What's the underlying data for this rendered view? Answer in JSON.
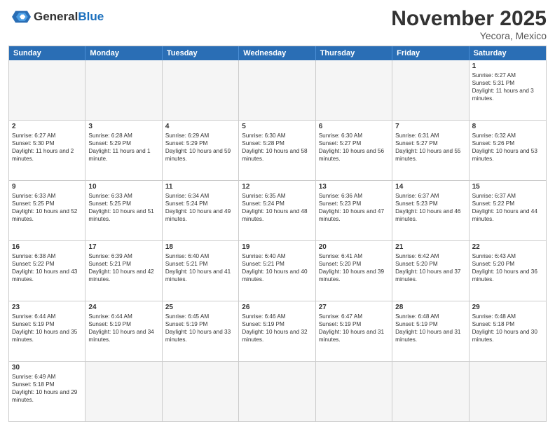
{
  "header": {
    "logo_general": "General",
    "logo_blue": "Blue",
    "title": "November 2025",
    "subtitle": "Yecora, Mexico"
  },
  "days_of_week": [
    "Sunday",
    "Monday",
    "Tuesday",
    "Wednesday",
    "Thursday",
    "Friday",
    "Saturday"
  ],
  "weeks": [
    [
      {
        "day": "",
        "text": ""
      },
      {
        "day": "",
        "text": ""
      },
      {
        "day": "",
        "text": ""
      },
      {
        "day": "",
        "text": ""
      },
      {
        "day": "",
        "text": ""
      },
      {
        "day": "",
        "text": ""
      },
      {
        "day": "1",
        "text": "Sunrise: 6:27 AM\nSunset: 5:31 PM\nDaylight: 11 hours and 3 minutes."
      }
    ],
    [
      {
        "day": "2",
        "text": "Sunrise: 6:27 AM\nSunset: 5:30 PM\nDaylight: 11 hours and 2 minutes."
      },
      {
        "day": "3",
        "text": "Sunrise: 6:28 AM\nSunset: 5:29 PM\nDaylight: 11 hours and 1 minute."
      },
      {
        "day": "4",
        "text": "Sunrise: 6:29 AM\nSunset: 5:29 PM\nDaylight: 10 hours and 59 minutes."
      },
      {
        "day": "5",
        "text": "Sunrise: 6:30 AM\nSunset: 5:28 PM\nDaylight: 10 hours and 58 minutes."
      },
      {
        "day": "6",
        "text": "Sunrise: 6:30 AM\nSunset: 5:27 PM\nDaylight: 10 hours and 56 minutes."
      },
      {
        "day": "7",
        "text": "Sunrise: 6:31 AM\nSunset: 5:27 PM\nDaylight: 10 hours and 55 minutes."
      },
      {
        "day": "8",
        "text": "Sunrise: 6:32 AM\nSunset: 5:26 PM\nDaylight: 10 hours and 53 minutes."
      }
    ],
    [
      {
        "day": "9",
        "text": "Sunrise: 6:33 AM\nSunset: 5:25 PM\nDaylight: 10 hours and 52 minutes."
      },
      {
        "day": "10",
        "text": "Sunrise: 6:33 AM\nSunset: 5:25 PM\nDaylight: 10 hours and 51 minutes."
      },
      {
        "day": "11",
        "text": "Sunrise: 6:34 AM\nSunset: 5:24 PM\nDaylight: 10 hours and 49 minutes."
      },
      {
        "day": "12",
        "text": "Sunrise: 6:35 AM\nSunset: 5:24 PM\nDaylight: 10 hours and 48 minutes."
      },
      {
        "day": "13",
        "text": "Sunrise: 6:36 AM\nSunset: 5:23 PM\nDaylight: 10 hours and 47 minutes."
      },
      {
        "day": "14",
        "text": "Sunrise: 6:37 AM\nSunset: 5:23 PM\nDaylight: 10 hours and 46 minutes."
      },
      {
        "day": "15",
        "text": "Sunrise: 6:37 AM\nSunset: 5:22 PM\nDaylight: 10 hours and 44 minutes."
      }
    ],
    [
      {
        "day": "16",
        "text": "Sunrise: 6:38 AM\nSunset: 5:22 PM\nDaylight: 10 hours and 43 minutes."
      },
      {
        "day": "17",
        "text": "Sunrise: 6:39 AM\nSunset: 5:21 PM\nDaylight: 10 hours and 42 minutes."
      },
      {
        "day": "18",
        "text": "Sunrise: 6:40 AM\nSunset: 5:21 PM\nDaylight: 10 hours and 41 minutes."
      },
      {
        "day": "19",
        "text": "Sunrise: 6:40 AM\nSunset: 5:21 PM\nDaylight: 10 hours and 40 minutes."
      },
      {
        "day": "20",
        "text": "Sunrise: 6:41 AM\nSunset: 5:20 PM\nDaylight: 10 hours and 39 minutes."
      },
      {
        "day": "21",
        "text": "Sunrise: 6:42 AM\nSunset: 5:20 PM\nDaylight: 10 hours and 37 minutes."
      },
      {
        "day": "22",
        "text": "Sunrise: 6:43 AM\nSunset: 5:20 PM\nDaylight: 10 hours and 36 minutes."
      }
    ],
    [
      {
        "day": "23",
        "text": "Sunrise: 6:44 AM\nSunset: 5:19 PM\nDaylight: 10 hours and 35 minutes."
      },
      {
        "day": "24",
        "text": "Sunrise: 6:44 AM\nSunset: 5:19 PM\nDaylight: 10 hours and 34 minutes."
      },
      {
        "day": "25",
        "text": "Sunrise: 6:45 AM\nSunset: 5:19 PM\nDaylight: 10 hours and 33 minutes."
      },
      {
        "day": "26",
        "text": "Sunrise: 6:46 AM\nSunset: 5:19 PM\nDaylight: 10 hours and 32 minutes."
      },
      {
        "day": "27",
        "text": "Sunrise: 6:47 AM\nSunset: 5:19 PM\nDaylight: 10 hours and 31 minutes."
      },
      {
        "day": "28",
        "text": "Sunrise: 6:48 AM\nSunset: 5:19 PM\nDaylight: 10 hours and 31 minutes."
      },
      {
        "day": "29",
        "text": "Sunrise: 6:48 AM\nSunset: 5:18 PM\nDaylight: 10 hours and 30 minutes."
      }
    ],
    [
      {
        "day": "30",
        "text": "Sunrise: 6:49 AM\nSunset: 5:18 PM\nDaylight: 10 hours and 29 minutes."
      },
      {
        "day": "",
        "text": ""
      },
      {
        "day": "",
        "text": ""
      },
      {
        "day": "",
        "text": ""
      },
      {
        "day": "",
        "text": ""
      },
      {
        "day": "",
        "text": ""
      },
      {
        "day": "",
        "text": ""
      }
    ]
  ]
}
